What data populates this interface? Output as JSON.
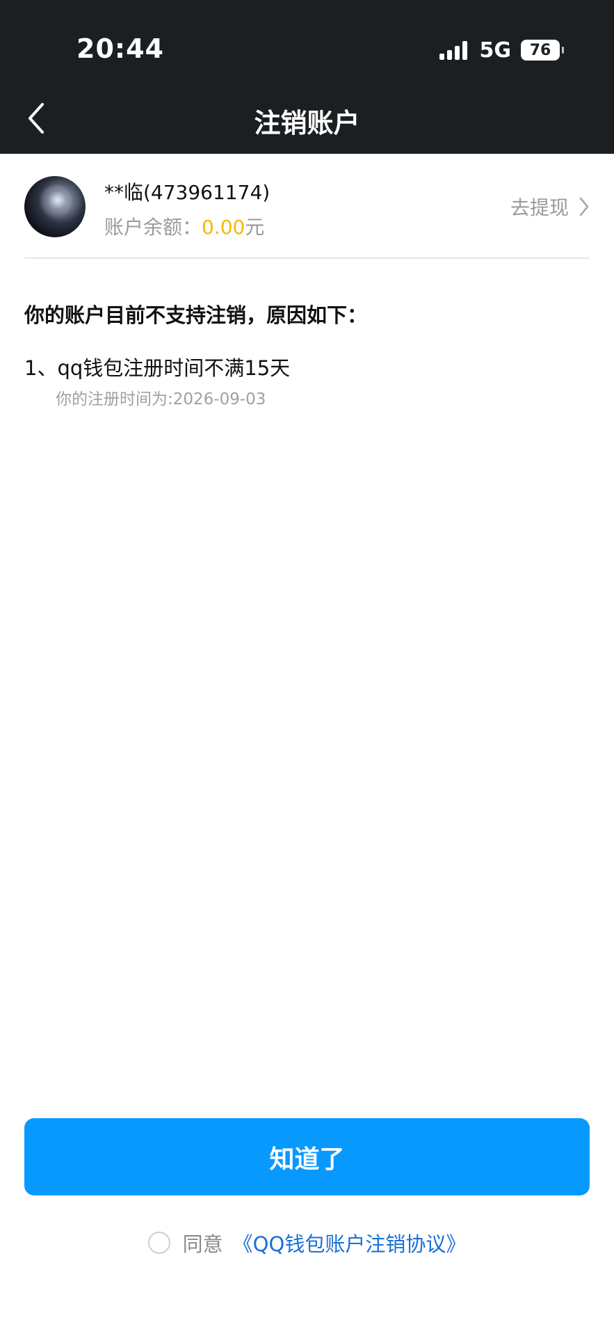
{
  "status_bar": {
    "time": "20:44",
    "network": "5G",
    "battery": "76",
    "signal_bars": 4
  },
  "nav": {
    "title": "注销账户",
    "back_icon": "chevron-left-icon"
  },
  "account": {
    "name": "**临(473961174)",
    "balance_label": "账户余额：",
    "balance_amount": "0.00",
    "balance_unit": "元",
    "withdraw_label": "去提现",
    "withdraw_icon": "chevron-right-icon"
  },
  "reasons": {
    "title": "你的账户目前不支持注销，原因如下：",
    "items": [
      {
        "text": "1、qq钱包注册时间不满15天",
        "detail": "你的注册时间为:2026-09-03"
      }
    ]
  },
  "actions": {
    "confirm_label": "知道了"
  },
  "agreement": {
    "agree_label": "同意",
    "link_label": "《QQ钱包账户注销协议》",
    "checked": false
  },
  "colors": {
    "header_bg": "#1c1f21",
    "primary_button": "#0899ff",
    "amount": "#f5b800",
    "link": "#1a6fd6"
  }
}
